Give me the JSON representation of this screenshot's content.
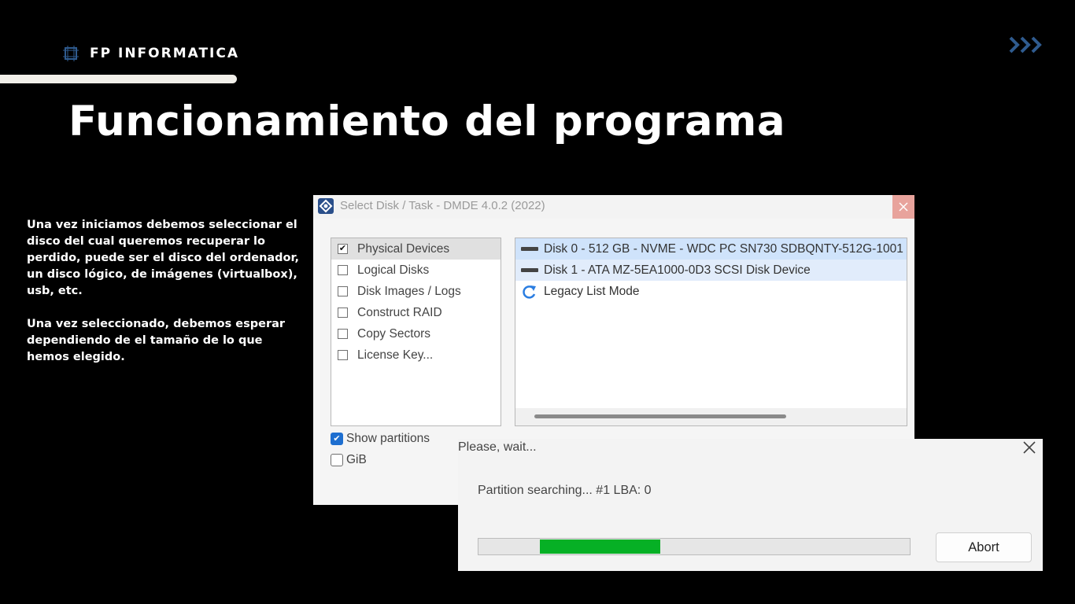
{
  "slide": {
    "brand": "FP INFORMATICA",
    "brand_icon": "grid-frame-icon",
    "nav_icon": "triple-chevron-right-icon",
    "title": "Funcionamiento del programa",
    "paragraphs": [
      "Una vez iniciamos debemos seleccionar el disco del cual queremos recuperar lo perdido, puede ser el disco del ordenador, un disco lógico, de imágenes (virtualbox), usb, etc.",
      "Una vez seleccionado, debemos esperar dependiendo de el tamaño de lo que hemos elegido."
    ],
    "colors": {
      "background": "#000000",
      "text": "#ffffff",
      "accent": "#2f5b8f",
      "bar": "#f1efe9"
    }
  },
  "dmde_window": {
    "title": "Select Disk / Task - DMDE 4.0.2 (2022)",
    "app_icon": "dmde-diamond-icon",
    "tasks": [
      {
        "label": "Physical Devices",
        "checked": true
      },
      {
        "label": "Logical Disks",
        "checked": false
      },
      {
        "label": "Disk Images / Logs",
        "checked": false
      },
      {
        "label": "Construct RAID",
        "checked": false
      },
      {
        "label": "Copy Sectors",
        "checked": false
      },
      {
        "label": "License Key...",
        "checked": false
      }
    ],
    "devices": [
      {
        "label": "Disk 0 - 512 GB - NVME - WDC PC SN730 SDBQNTY-512G-1001",
        "icon": "drive-icon"
      },
      {
        "label": "Disk 1 - ATA MZ-5EA1000-0D3 SCSI Disk Device",
        "icon": "drive-icon"
      },
      {
        "label": "Legacy List Mode",
        "icon": "refresh-icon"
      }
    ],
    "options": [
      {
        "label": "Show partitions",
        "checked": true
      },
      {
        "label": "GiB",
        "checked": false
      }
    ]
  },
  "wait_dialog": {
    "title": "Please, wait...",
    "status": "Partition searching...  #1  LBA: 0",
    "progress": 0.28,
    "abort_label": "Abort",
    "progress_color": "#06b025"
  }
}
